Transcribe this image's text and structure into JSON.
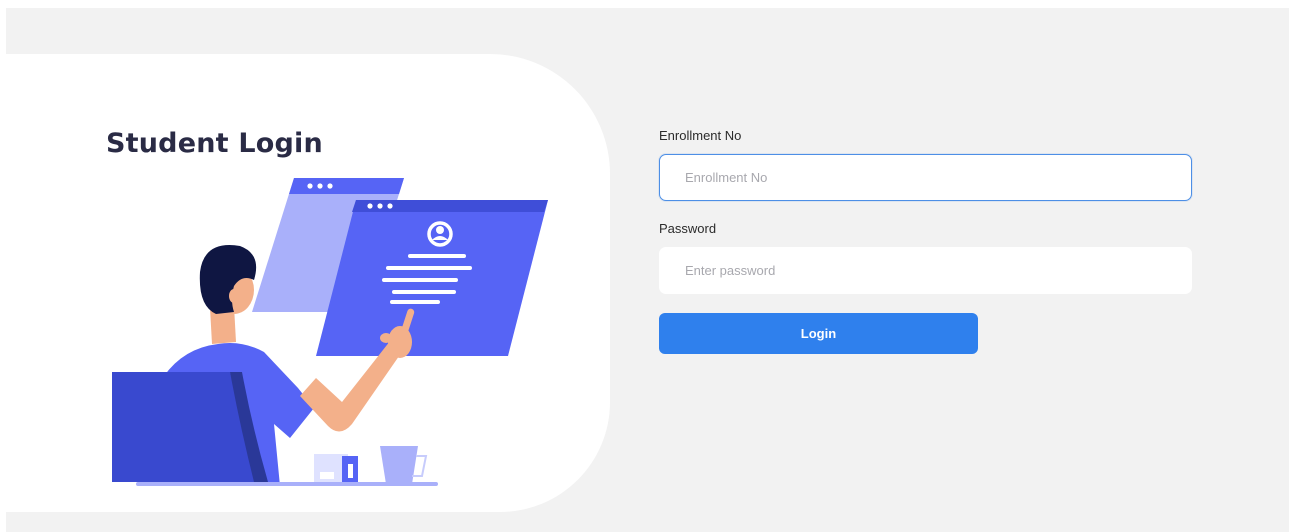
{
  "card": {
    "title": "Student Login"
  },
  "form": {
    "enrollment": {
      "label": "Enrollment No",
      "placeholder": "Enrollment No",
      "value": ""
    },
    "password": {
      "label": "Password",
      "placeholder": "Enter password",
      "value": ""
    },
    "submit_label": "Login"
  },
  "colors": {
    "page_bg": "#f2f2f2",
    "card_bg": "#ffffff",
    "accent": "#2f80ed",
    "title": "#2a2b45",
    "illustration_primary": "#5664f5",
    "illustration_light": "#a9b0fa",
    "hair": "#0f1642",
    "skin": "#f3b08a"
  },
  "icons": {
    "illustration": "person-at-computer-illustration",
    "profile": "user-profile-icon"
  }
}
